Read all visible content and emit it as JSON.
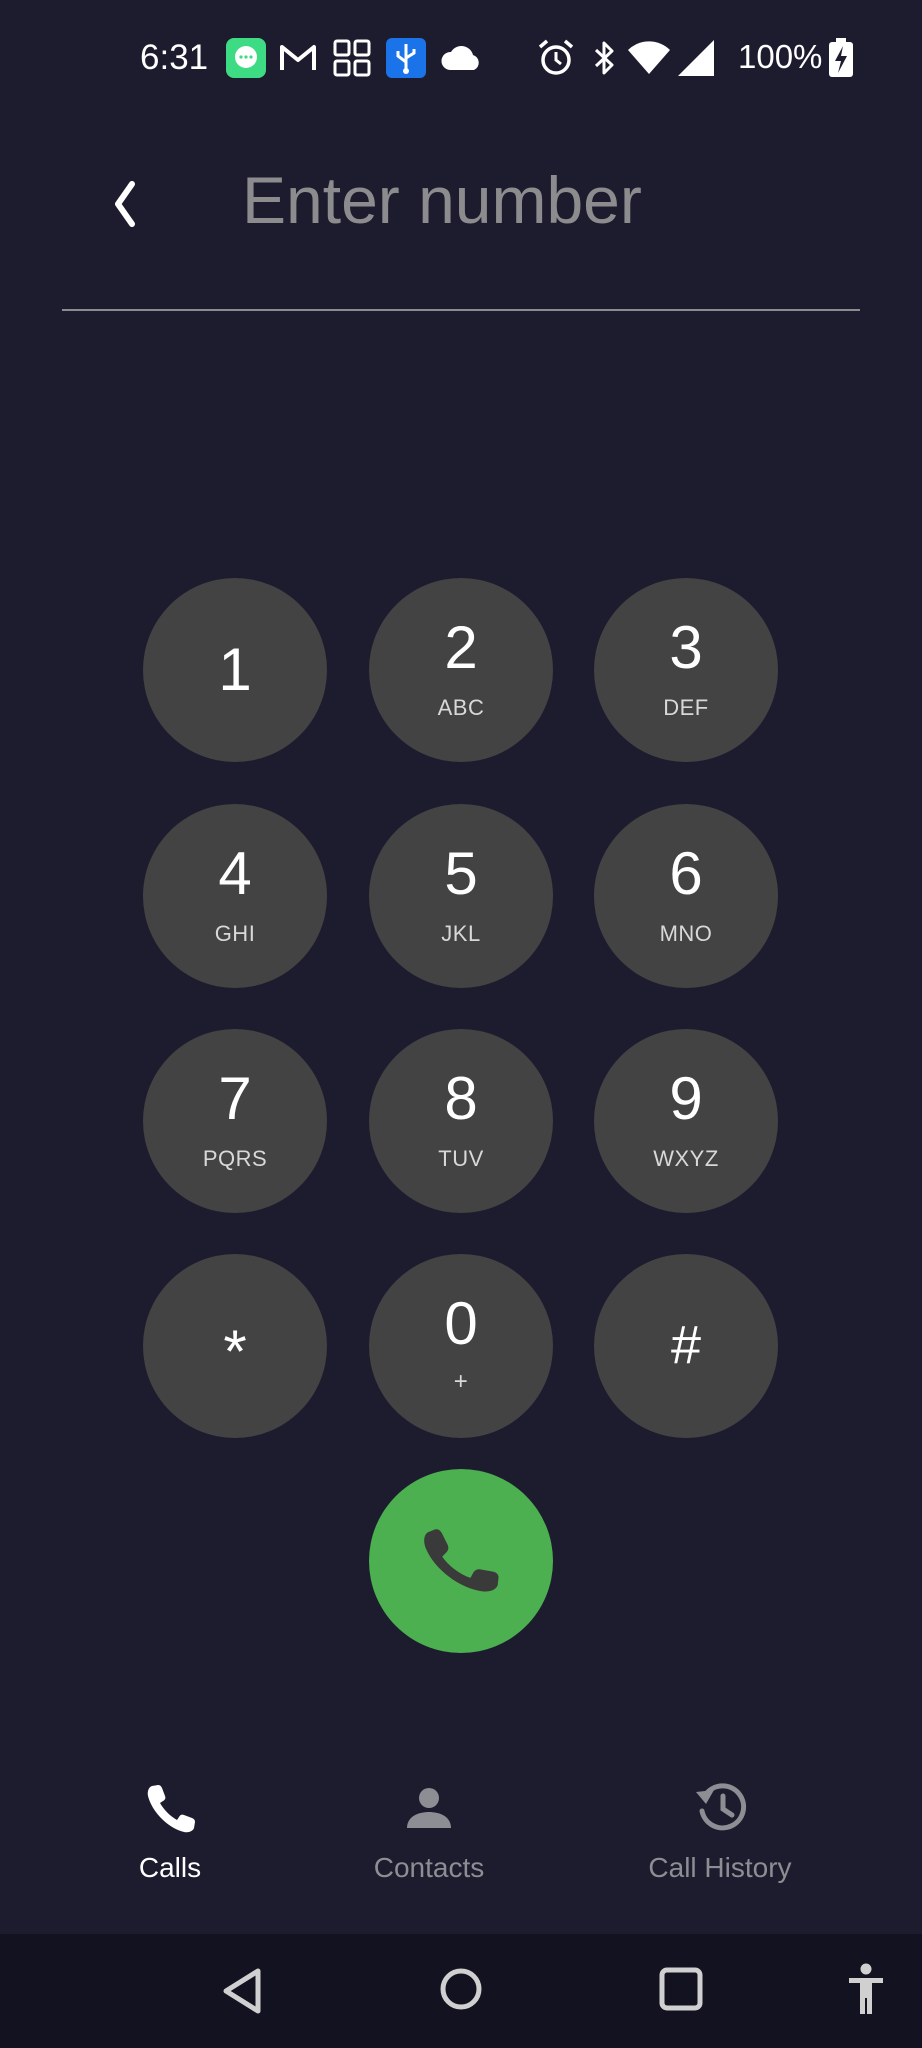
{
  "status_bar": {
    "time": "6:31",
    "battery": "100%",
    "icons": [
      "messages-icon",
      "gmail-icon",
      "apps-grid-icon",
      "usb-icon",
      "cloud-icon",
      "alarm-icon",
      "bluetooth-icon",
      "wifi-icon",
      "signal-icon",
      "battery-charging-icon"
    ]
  },
  "header": {
    "placeholder": "Enter number",
    "value": ""
  },
  "keypad": {
    "keys": [
      {
        "digit": "1",
        "letters": ""
      },
      {
        "digit": "2",
        "letters": "ABC"
      },
      {
        "digit": "3",
        "letters": "DEF"
      },
      {
        "digit": "4",
        "letters": "GHI"
      },
      {
        "digit": "5",
        "letters": "JKL"
      },
      {
        "digit": "6",
        "letters": "MNO"
      },
      {
        "digit": "7",
        "letters": "PQRS"
      },
      {
        "digit": "8",
        "letters": "TUV"
      },
      {
        "digit": "9",
        "letters": "WXYZ"
      },
      {
        "digit": "*",
        "letters": ""
      },
      {
        "digit": "0",
        "letters": "+"
      },
      {
        "digit": "#",
        "letters": ""
      }
    ],
    "call_icon": "phone-icon"
  },
  "tabs": [
    {
      "label": "Calls",
      "icon": "phone-icon",
      "active": true
    },
    {
      "label": "Contacts",
      "icon": "person-icon",
      "active": false
    },
    {
      "label": "Call History",
      "icon": "history-icon",
      "active": false
    }
  ],
  "colors": {
    "background": "#1d1c2e",
    "key": "#434343",
    "call": "#4caf50",
    "active_tab": "#ffffff",
    "inactive_tab": "#8d8d94"
  }
}
